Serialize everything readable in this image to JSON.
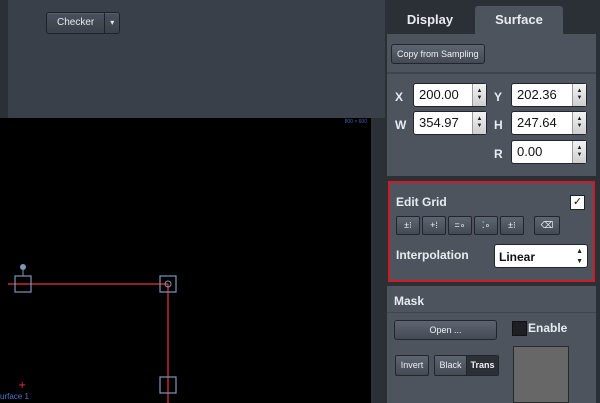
{
  "toolbar": {
    "view_select_label": "Checker",
    "view_select_arrow": "▾"
  },
  "canvas": {
    "size_label": "800 × 600",
    "surface_label": "urface 1"
  },
  "tabs": [
    {
      "label": "Display"
    },
    {
      "label": "Surface"
    }
  ],
  "surface": {
    "copy_button": "Copy from Sampling",
    "fields": {
      "x": {
        "label": "X",
        "value": "200.00"
      },
      "y": {
        "label": "Y",
        "value": "202.36"
      },
      "w": {
        "label": "W",
        "value": "354.97"
      },
      "h": {
        "label": "H",
        "value": "247.64"
      },
      "r": {
        "label": "R",
        "value": "0.00"
      }
    }
  },
  "edit_grid": {
    "title": "Edit Grid",
    "checked": true,
    "interpolation_label": "Interpolation",
    "interpolation_value": "Linear",
    "buttons": [
      "add-row",
      "add-column",
      "remove-row",
      "remove-column",
      "add-point"
    ]
  },
  "mask": {
    "title": "Mask",
    "open_button": "Open ...",
    "enable_label": "Enable",
    "invert_button": "Invert",
    "black_label": "Black",
    "trans_label": "Trans"
  },
  "colors": {
    "accent_red": "#d01b24",
    "panel": "#4d545e",
    "canvas_line": "#e8333f",
    "handle": "#7d97b8"
  }
}
